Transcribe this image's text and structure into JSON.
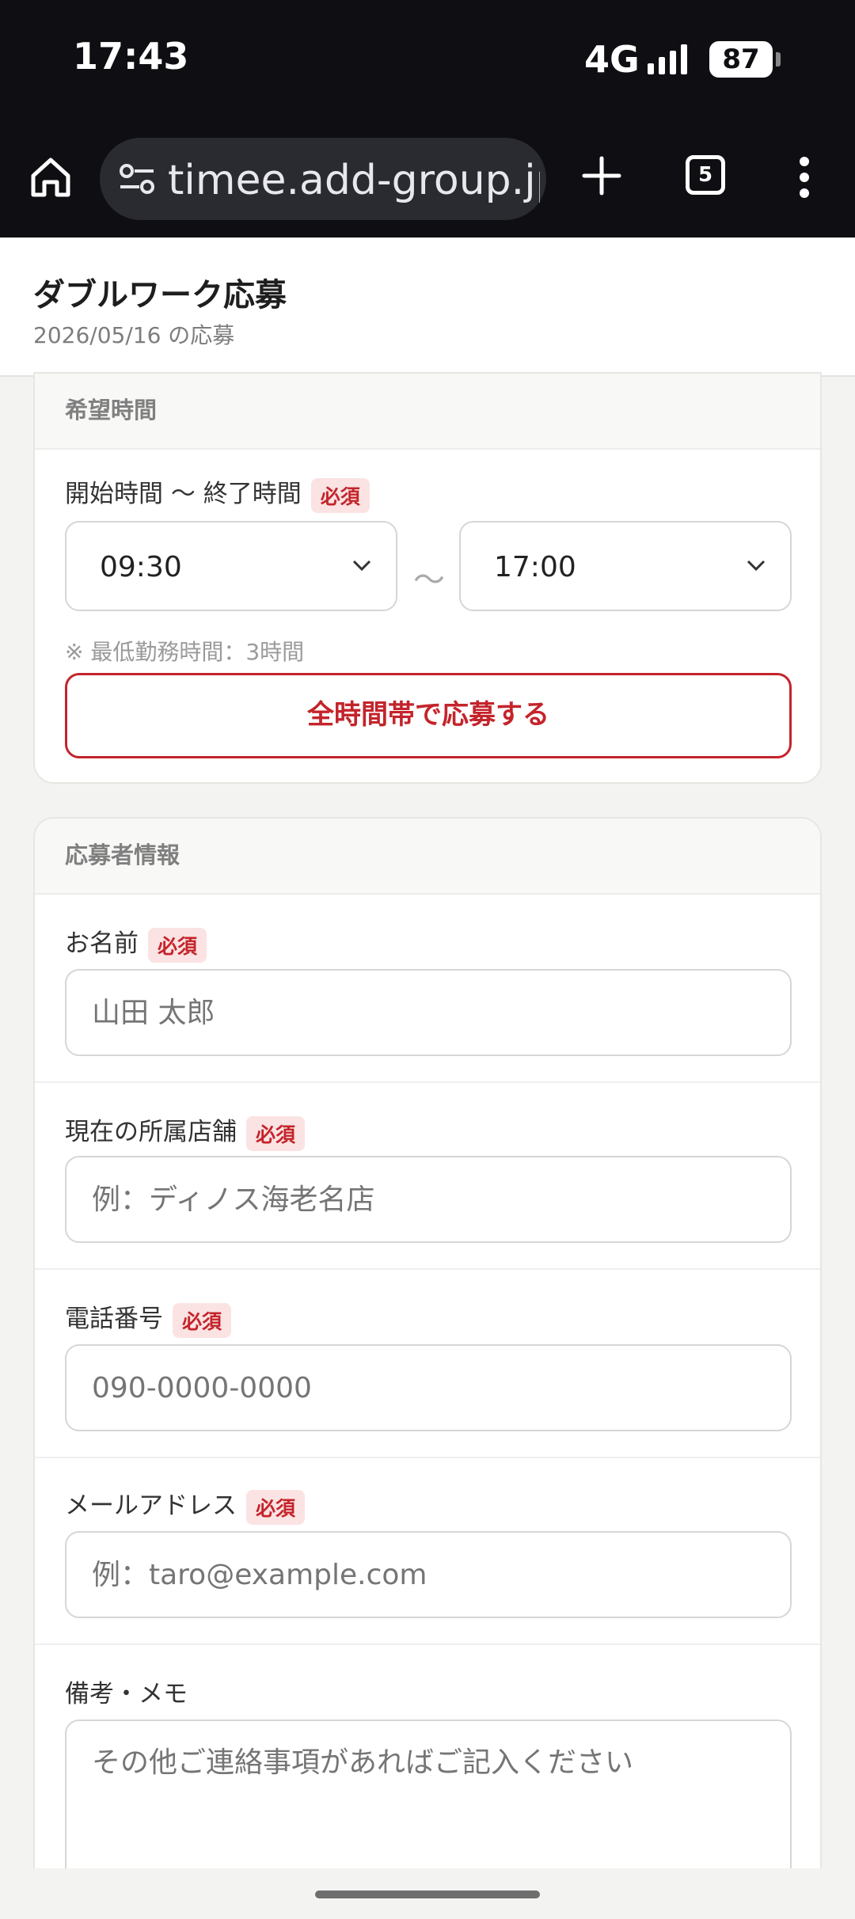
{
  "status_bar": {
    "time": "17:43",
    "network": "4G",
    "battery": "87"
  },
  "browser": {
    "url": "timee.add-group.jp",
    "tab_count": "5"
  },
  "header": {
    "title": "ダブルワーク応募",
    "subtitle": "2026/05/16 の応募"
  },
  "time_section": {
    "heading": "希望時間",
    "label": "開始時間 〜 終了時間",
    "required": "必須",
    "start": "09:30",
    "separator": "〜",
    "end": "17:00",
    "hint": "※ 最低勤務時間：3時間",
    "all_button": "全時間帯で応募する"
  },
  "applicant_section": {
    "heading": "応募者情報",
    "required": "必須",
    "fields": [
      {
        "label": "お名前",
        "placeholder": "山田 太郎"
      },
      {
        "label": "現在の所属店舗",
        "placeholder": "例：ディノス海老名店"
      },
      {
        "label": "電話番号",
        "placeholder": "090-0000-0000"
      },
      {
        "label": "メールアドレス",
        "placeholder": "例：taro@example.com"
      }
    ],
    "memo_label": "備考・メモ",
    "memo_placeholder": "その他ご連絡事項があればご記入ください"
  },
  "colors": {
    "accent": "#c4242b",
    "required_bg": "#fbe3e3",
    "chrome": "#0f0f13"
  }
}
